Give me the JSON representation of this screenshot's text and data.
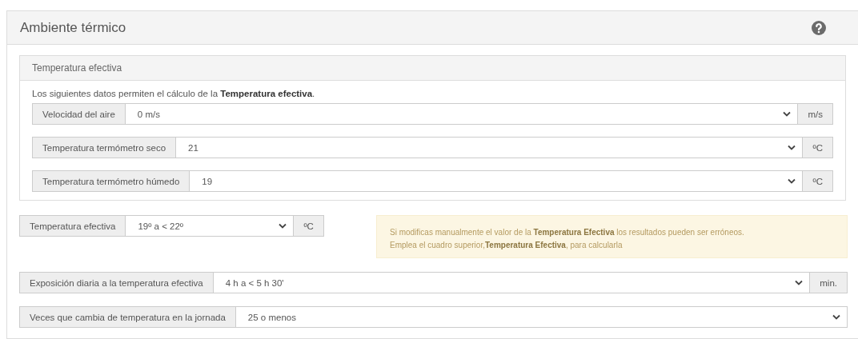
{
  "panel": {
    "title": "Ambiente térmico"
  },
  "subpanel": {
    "title": "Temperatura efectiva",
    "intro": "Los siguientes datos permiten el cálculo de la **Temperatura efectiva**.",
    "fields": [
      {
        "label": "Velocidad del aire",
        "value": "0 m/s",
        "unit": "m/s"
      },
      {
        "label": "Temperatura termómetro seco",
        "value": "21",
        "unit": "ºC"
      },
      {
        "label": "Temperatura termómetro húmedo",
        "value": "19",
        "unit": "ºC"
      }
    ]
  },
  "effective": {
    "label": "Temperatura efectiva",
    "value": "19º a < 22º",
    "unit": "ºC"
  },
  "warning": [
    "Si modificas manualmente el valor de la **Temperatura Efectiva** los resultados pueden ser erróneos.",
    "Emplea el cuadro superior,**Temperatura Efectiva**, para calcularla"
  ],
  "fields": [
    {
      "label": "Exposición diaria a la temperatura efectiva",
      "value": "4 h a < 5 h 30'",
      "unit": "min."
    },
    {
      "label": "Veces que cambia de temperatura en la jornada",
      "value": "25 o menos"
    }
  ]
}
